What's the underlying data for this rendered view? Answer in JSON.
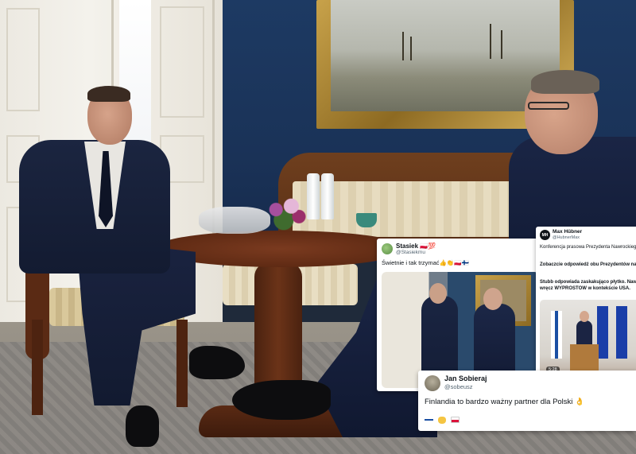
{
  "overlays": {
    "post_a": {
      "name": "Stasiek 🇵🇱💯",
      "handle": "@Stasiekmu",
      "text": "Świetnie i tak trzymać👍👏🇵🇱🇫🇮"
    },
    "post_b": {
      "avatar_initials": "MH",
      "name": "Max Hübner",
      "handle": "@HubnerMax",
      "text_1": "Konferencja prasowa Prezydenta Nawrockiego i P zaskakująca.",
      "text_2": "Zobaczcie odpowiedź obu Prezydentów na pyt i Polski z USA.",
      "text_3": "Stubb odpowiada zaskakująco płytko. Nawrocki przeciwnie – on wręcz WYPROSTOW w kontekście USA.",
      "video_time": "5:28"
    },
    "post_c": {
      "name": "Jan Sobieraj",
      "handle": "@sobeusz",
      "text": "Finlandia to bardzo ważny partner dla Polski 👌"
    }
  },
  "colors": {
    "wall": "#1d3a63",
    "frame_gold": "#c8a24a",
    "card_bg": "#ffffff",
    "handle_gray": "#536471"
  }
}
